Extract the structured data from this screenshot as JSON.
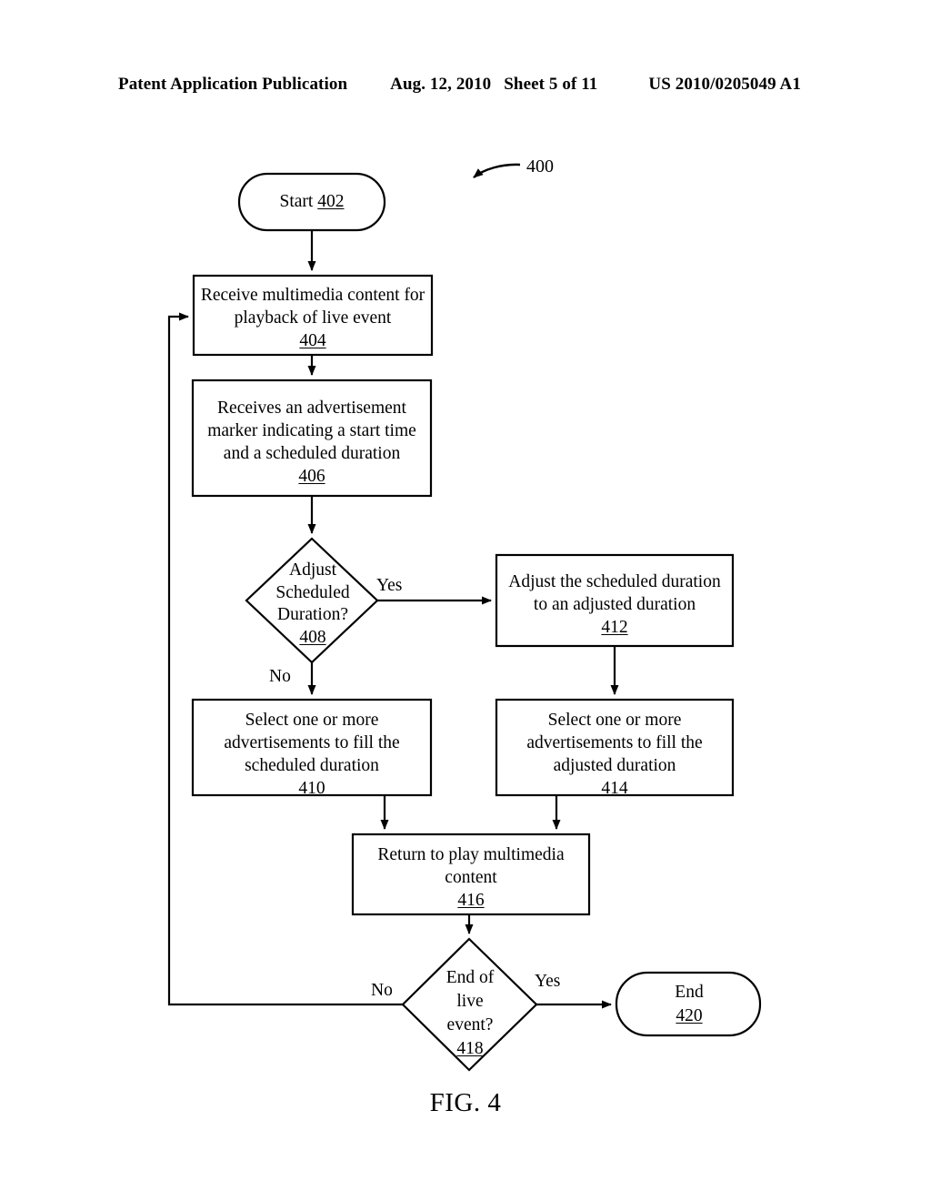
{
  "header": {
    "publication": "Patent Application Publication",
    "date": "Aug. 12, 2010",
    "sheet": "Sheet 5 of 11",
    "patent_number": "US 2010/0205049 A1"
  },
  "figure": {
    "caption": "FIG. 4",
    "diagram_ref": "400",
    "nodes": {
      "start": {
        "label": "Start ",
        "ref": "402",
        "shape": "stadium"
      },
      "n404": {
        "line1": "Receive multimedia content for",
        "line2": "playback of live event",
        "ref": "404",
        "shape": "rect"
      },
      "n406": {
        "line1": "Receives an advertisement",
        "line2": "marker indicating a start time",
        "line3": "and a scheduled duration",
        "ref": "406",
        "shape": "rect"
      },
      "n408": {
        "line1": "Adjust",
        "line2": "Scheduled",
        "line3": "Duration?",
        "ref": "408",
        "shape": "diamond"
      },
      "n410": {
        "line1": "Select one or more",
        "line2": "advertisements to fill the",
        "line3": "scheduled duration",
        "ref": "410",
        "shape": "rect"
      },
      "n412": {
        "line1": "Adjust the scheduled duration",
        "line2": "to an adjusted duration",
        "ref": "412",
        "shape": "rect"
      },
      "n414": {
        "line1": "Select one or more",
        "line2": "advertisements to fill the",
        "line3": "adjusted duration",
        "ref": "414",
        "shape": "rect"
      },
      "n416": {
        "line1": "Return to play multimedia",
        "line2": "content",
        "ref": "416",
        "shape": "rect"
      },
      "n418": {
        "line1": "End of",
        "line2": "live",
        "line3": "event?",
        "ref": "418",
        "shape": "diamond"
      },
      "end": {
        "label": "End",
        "ref": "420",
        "shape": "stadium"
      }
    },
    "edge_labels": {
      "yes_408": "Yes",
      "no_408": "No",
      "no_418": "No",
      "yes_418": "Yes"
    },
    "colors": {
      "stroke": "#000000",
      "fill": "#ffffff",
      "text": "#000000"
    }
  }
}
